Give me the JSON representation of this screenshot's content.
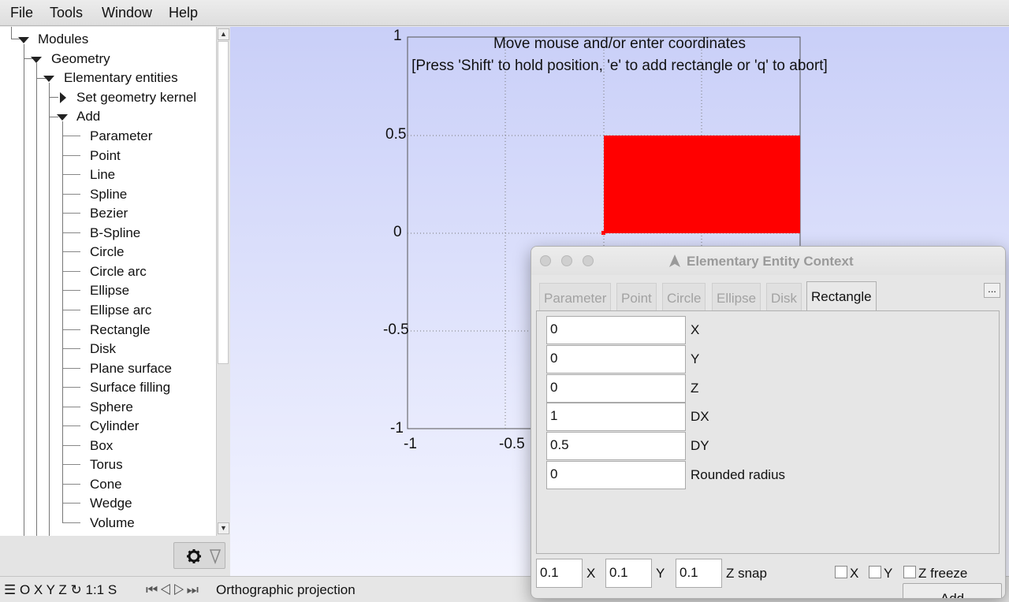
{
  "menu": {
    "file": "File",
    "tools": "Tools",
    "window": "Window",
    "help": "Help"
  },
  "tree": {
    "modules": "Modules",
    "geometry": "Geometry",
    "elementary": "Elementary entities",
    "set_kernel": "Set geometry kernel",
    "add": "Add",
    "items": [
      "Parameter",
      "Point",
      "Line",
      "Spline",
      "Bezier",
      "B-Spline",
      "Circle",
      "Circle arc",
      "Ellipse",
      "Ellipse arc",
      "Rectangle",
      "Disk",
      "Plane surface",
      "Surface filling",
      "Sphere",
      "Cylinder",
      "Box",
      "Torus",
      "Cone",
      "Wedge",
      "Volume"
    ]
  },
  "graphics": {
    "message_line1": "Move mouse and/or enter coordinates",
    "message_line2": "[Press 'Shift' to hold position, 'e' to add rectangle or 'q' to abort]",
    "y_ticks": [
      "1",
      "0.5",
      "0",
      "-0.5",
      "-1"
    ],
    "x_ticks": [
      "-1",
      "-0.5"
    ],
    "rect_color": "#ff0000"
  },
  "status": {
    "icons": "☰ O X Y Z ↻ 1:1 S",
    "projection": "Orthographic projection"
  },
  "dialog": {
    "title": "Elementary Entity Context",
    "tabs": [
      "Parameter",
      "Point",
      "Circle",
      "Ellipse",
      "Disk",
      "Rectangle"
    ],
    "active_tab": "Rectangle",
    "more_label": "...",
    "fields": [
      {
        "label": "X",
        "value": "0"
      },
      {
        "label": "Y",
        "value": "0"
      },
      {
        "label": "Z",
        "value": "0"
      },
      {
        "label": "DX",
        "value": "1"
      },
      {
        "label": "DY",
        "value": "0.5"
      },
      {
        "label": "Rounded radius",
        "value": "0"
      }
    ],
    "add_label": "Add",
    "snap": {
      "x_value": "0.1",
      "y_value": "0.1",
      "z_value": "0.1",
      "x_label": "X",
      "y_label": "Y",
      "z_label": "Z snap"
    },
    "freeze": {
      "x_label": "X",
      "y_label": "Y",
      "z_label": "Z freeze"
    }
  }
}
